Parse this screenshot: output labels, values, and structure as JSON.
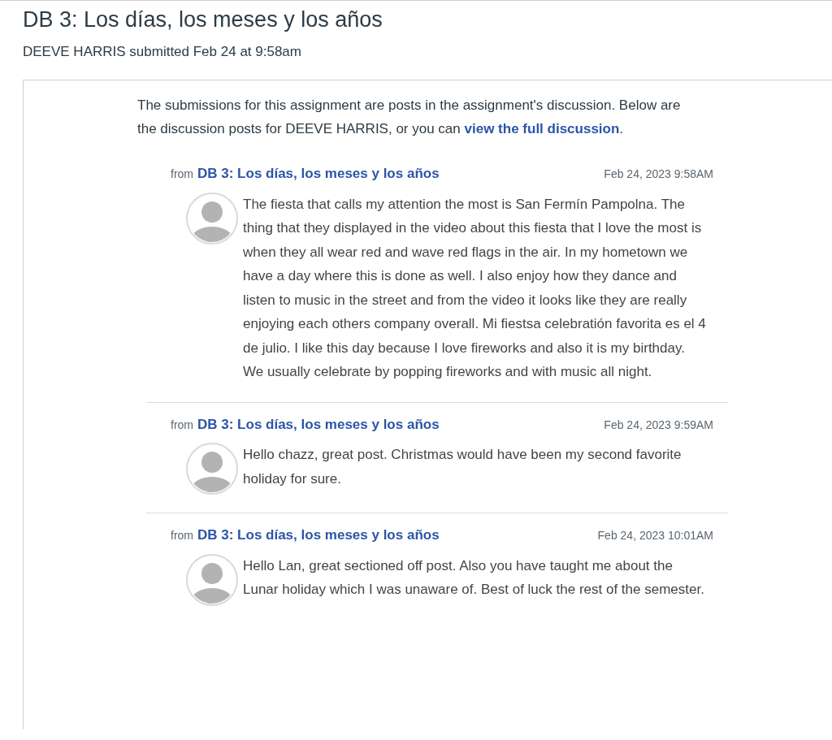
{
  "page_title": "DB 3: Los días, los meses y los años",
  "submission_info": "DEEVE HARRIS submitted Feb 24 at 9:58am",
  "intro": {
    "text": "The submissions for this assignment are posts in the assignment's discussion. Below are the discussion posts for DEEVE HARRIS, or you can",
    "link": "view the full discussion",
    "after": "."
  },
  "posts": [
    {
      "from_label": "from",
      "thread": "DB 3: Los días, los meses y los años",
      "date": "Feb 24, 2023 9:58AM",
      "body": "The fiesta that calls my attention the most is San Fermín Pampolna. The thing that they displayed in the video about this fiesta that I love the most is when they all wear red and wave red flags in the air. In my hometown we have a day where this is done as well. I also enjoy how they dance and listen to music in the street and from the video it looks like they are really enjoying each others company overall. Mi fiestsa celebratión favorita es el 4 de julio. I like this day because I love fireworks and also it is my birthday. We usually celebrate by popping fireworks and with music all night."
    },
    {
      "from_label": "from",
      "thread": "DB 3: Los días, los meses y los años",
      "date": "Feb 24, 2023 9:59AM",
      "body": "Hello chazz, great post.  Christmas would have been my second favorite holiday for sure."
    },
    {
      "from_label": "from",
      "thread": "DB 3: Los días, los meses y los años",
      "date": "Feb 24, 2023 10:01AM",
      "body": "Hello Lan, great sectioned off post. Also you have taught me about the Lunar holiday which I was unaware of. Best of luck the rest of the semester."
    }
  ]
}
